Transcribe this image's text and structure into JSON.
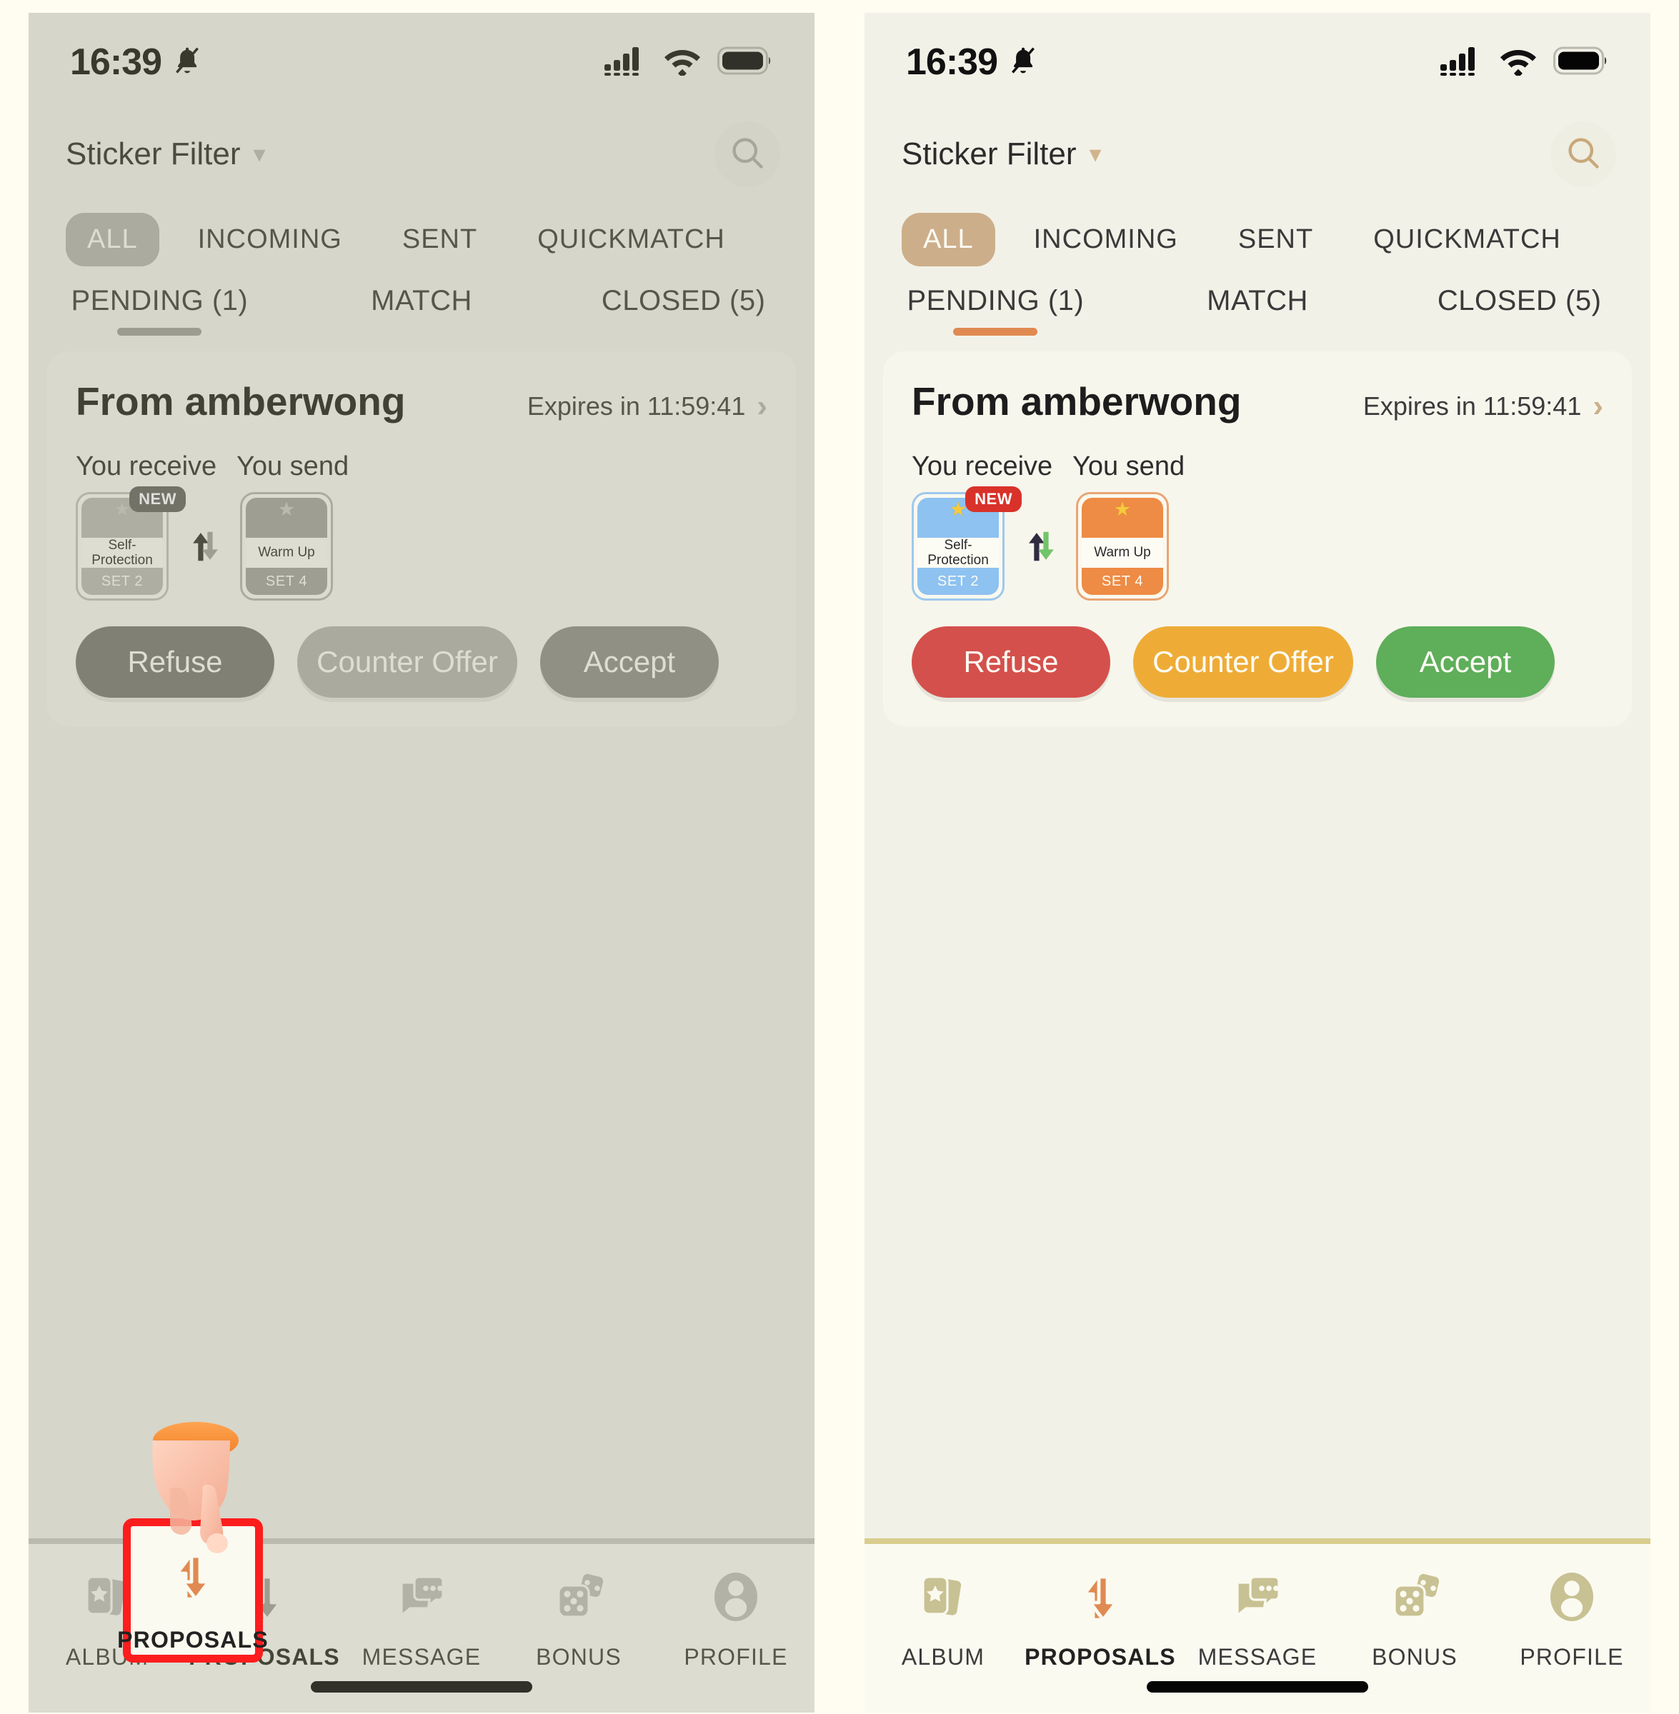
{
  "colors": {
    "page_bg": "#fffdf2",
    "panel_bg": "#f2f1e8",
    "card_bg": "#f7f6ec",
    "nav_bg": "#fbfaf0",
    "accent_tan": "#cdae8a",
    "accent_orange": "#e08a52",
    "highlight_red": "#fc1d1d",
    "refuse_red": "#d4504c",
    "counter_yellow": "#eeac37",
    "accept_green": "#5eae5a",
    "sticker_blue": "#8ec2f0",
    "sticker_orange": "#ee8b45",
    "nav_icon_khaki": "#c8c193",
    "nav_sep": "#d8cd8e",
    "dim_overlay": "#a7a79b"
  },
  "status_bar": {
    "time": "16:39",
    "mute_icon": "bell-slash-icon",
    "signal_icon": "cellular-signal-icon",
    "wifi_icon": "wifi-icon",
    "battery_icon": "battery-full-icon"
  },
  "header": {
    "filter_label": "Sticker Filter",
    "filter_chevron_icon": "chevron-down-icon",
    "search_icon": "search-icon"
  },
  "segments": [
    {
      "label": "ALL",
      "active": true
    },
    {
      "label": "INCOMING",
      "active": false
    },
    {
      "label": "SENT",
      "active": false
    },
    {
      "label": "QUICKMATCH",
      "active": false
    }
  ],
  "tabs": [
    {
      "label": "PENDING (1)",
      "active": true
    },
    {
      "label": "MATCH",
      "active": false
    },
    {
      "label": "CLOSED (5)",
      "active": false
    }
  ],
  "proposal": {
    "title": "From amberwong",
    "expires": "Expires in 11:59:41",
    "chevron_icon": "chevron-right-icon",
    "receive_label": "You receive",
    "send_label": "You send",
    "swap_icon": "swap-arrows-icon",
    "receive_sticker": {
      "name": "Self-Protection",
      "set": "SET 2",
      "badge": "NEW",
      "star_icon": "star-icon",
      "color": "blue"
    },
    "send_sticker": {
      "name": "Warm Up",
      "set": "SET 4",
      "badge": "",
      "star_icon": "star-icon",
      "color": "orange"
    },
    "actions": [
      {
        "label": "Refuse",
        "style": "refuse"
      },
      {
        "label": "Counter Offer",
        "style": "counter"
      },
      {
        "label": "Accept",
        "style": "accept"
      }
    ]
  },
  "bottom_nav": [
    {
      "label": "ALBUM",
      "icon": "album-cards-icon",
      "active": false
    },
    {
      "label": "PROPOSALS",
      "icon": "swap-arrows-icon",
      "active": true
    },
    {
      "label": "MESSAGE",
      "icon": "chat-bubbles-icon",
      "active": false
    },
    {
      "label": "BONUS",
      "icon": "dice-icon",
      "active": false
    },
    {
      "label": "PROFILE",
      "icon": "person-icon",
      "active": false
    }
  ],
  "annotation": {
    "highlight_target": "PROPOSALS",
    "cursor_icon": "pointing-hand-icon"
  }
}
